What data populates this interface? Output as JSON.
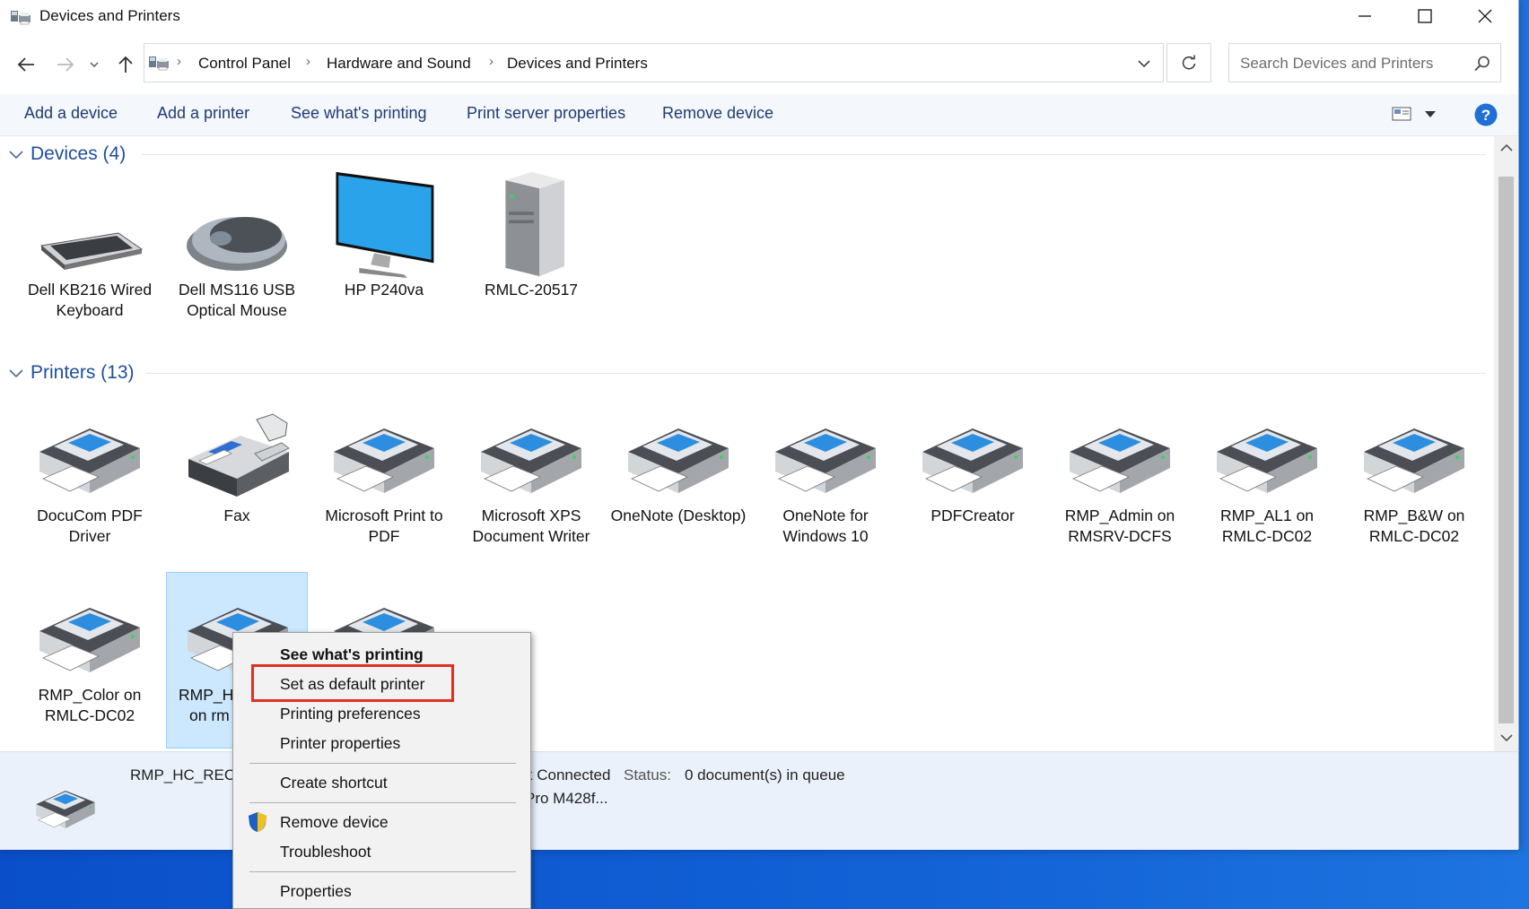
{
  "window": {
    "title": "Devices and Printers",
    "controls": {
      "minimize": "minimize-icon",
      "maximize": "maximize-icon",
      "close": "close-icon"
    }
  },
  "nav": {
    "breadcrumb": [
      "Control Panel",
      "Hardware and Sound",
      "Devices and Printers"
    ],
    "search_placeholder": "Search Devices and Printers"
  },
  "toolbar": {
    "commands": [
      "Add a device",
      "Add a printer",
      "See what's printing",
      "Print server properties",
      "Remove device"
    ]
  },
  "groups": {
    "devices": {
      "label": "Devices (4)",
      "items": [
        {
          "name": "Dell KB216 Wired Keyboard",
          "icon": "keyboard-icon"
        },
        {
          "name": "Dell MS116 USB Optical Mouse",
          "icon": "mouse-icon"
        },
        {
          "name": "HP P240va",
          "icon": "monitor-icon"
        },
        {
          "name": "RMLC-20517",
          "icon": "computer-tower-icon"
        }
      ]
    },
    "printers": {
      "label": "Printers (13)",
      "items": [
        {
          "name": "DocuCom PDF Driver",
          "icon": "printer-icon"
        },
        {
          "name": "Fax",
          "icon": "fax-icon"
        },
        {
          "name": "Microsoft Print to PDF",
          "icon": "printer-icon"
        },
        {
          "name": "Microsoft XPS Document Writer",
          "icon": "printer-icon"
        },
        {
          "name": "OneNote (Desktop)",
          "icon": "printer-icon"
        },
        {
          "name": "OneNote for Windows 10",
          "icon": "printer-icon"
        },
        {
          "name": "PDFCreator",
          "icon": "printer-icon"
        },
        {
          "name": "RMP_Admin on RMSRV-DCFS",
          "icon": "printer-icon"
        },
        {
          "name": "RMP_AL1 on RMLC-DC02",
          "icon": "printer-icon"
        },
        {
          "name": "RMP_B&W on RMLC-DC02",
          "icon": "printer-icon"
        },
        {
          "name": "RMP_Color on RMLC-DC02",
          "icon": "printer-icon"
        },
        {
          "name_line1": "RMP_H",
          "name_line2": "on rm",
          "icon": "printer-icon",
          "selected": true
        },
        {
          "name": "",
          "icon": "printer-icon"
        }
      ]
    }
  },
  "details": {
    "name": "RMP_HC_REC",
    "state_fragment": "k Connected",
    "status_label": "Status:",
    "status_value": "0 document(s) in queue",
    "model_fragment": "Pro M428f..."
  },
  "context_menu": {
    "items": [
      {
        "label": "See what's printing",
        "bold": true
      },
      {
        "label": "Set as default printer",
        "highlighted": true
      },
      {
        "label": "Printing preferences"
      },
      {
        "label": "Printer properties"
      },
      {
        "label": "Create shortcut"
      },
      {
        "label": "Remove device",
        "icon": "uac-shield-icon"
      },
      {
        "label": "Troubleshoot"
      },
      {
        "label": "Properties"
      }
    ],
    "highlight_color": "#e0301e"
  },
  "colors": {
    "accent": "#1e4fa0",
    "selection": "#cce8ff",
    "desktop": "#1262d6"
  }
}
